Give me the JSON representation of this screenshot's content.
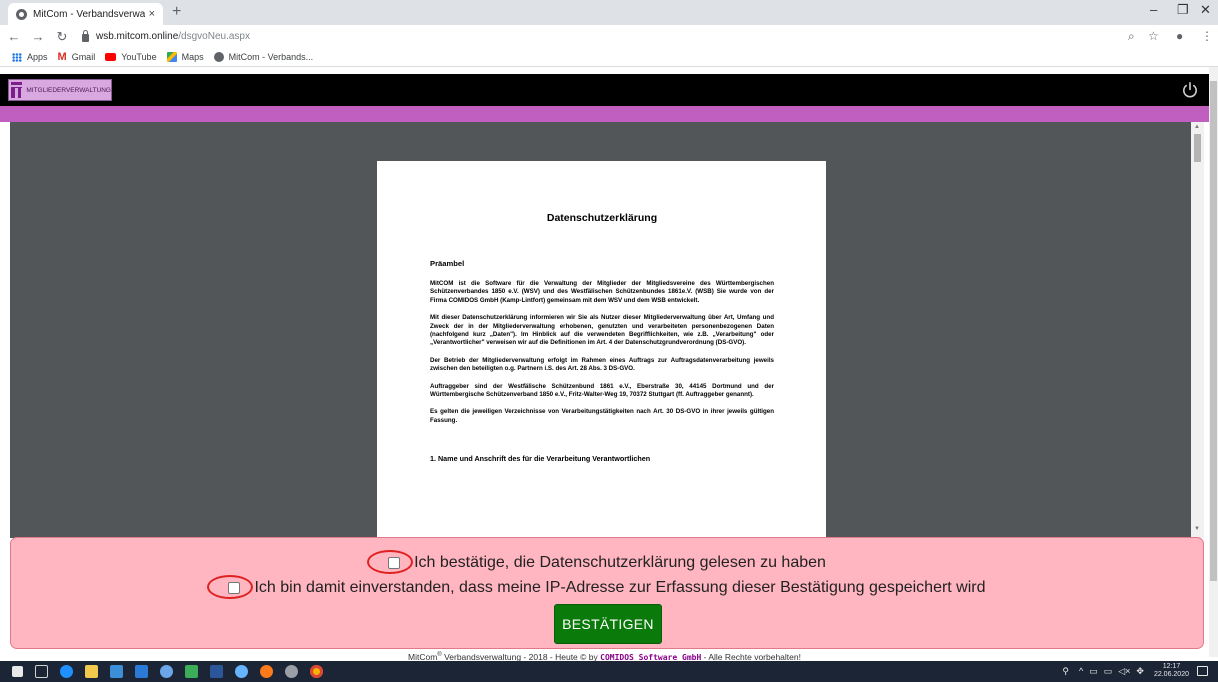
{
  "browser": {
    "tab_title": "MitCom - Verbandsverwaltung",
    "tab_close": "×",
    "new_tab": "+",
    "url_host": "wsb.mitcom.online",
    "url_path": "/dsgvoNeu.aspx",
    "bookmarks": [
      {
        "label": "Apps",
        "icon": "apps-icon"
      },
      {
        "label": "Gmail",
        "icon": "gmail-icon"
      },
      {
        "label": "YouTube",
        "icon": "youtube-icon"
      },
      {
        "label": "Maps",
        "icon": "maps-icon"
      },
      {
        "label": "MitCom - Verbands...",
        "icon": "mitcom-icon"
      }
    ]
  },
  "app": {
    "logo_text": "MITGLIEDERVERWALTUNG",
    "accent_color": "#c05fc0"
  },
  "document": {
    "title": "Datenschutzerklärung",
    "preamble_heading": "Präambel",
    "paragraphs": [
      "MitCOM ist die Software für die Verwaltung der Mitglieder der Mitgliedsvereine des Württembergischen Schützenverbandes 1850 e.V. (WSV) und des Westfälischen Schützenbundes 1861e.V. (WSB) Sie wurde von der Firma COMIDOS GmbH (Kamp-Lintfort) gemeinsam mit dem WSV und dem WSB entwickelt.",
      "Mit dieser Datenschutzerklärung informieren wir Sie als Nutzer dieser Mitgliederverwaltung über Art, Umfang und Zweck der in der Mitgliederverwaltung erhobenen, genutzten und verarbeiteten personenbezogenen Daten (nachfolgend kurz „Daten\"). Im Hinblick auf die verwendeten Begrifflichkeiten, wie z.B. „Verarbeitung\" oder „Verantwortlicher\" verweisen wir auf die Definitionen im Art. 4 der Datenschutzgrundverordnung (DS-GVO).",
      "Der Betrieb der Mitgliederverwaltung erfolgt im Rahmen eines Auftrags zur Auftragsdatenverarbeitung jeweils zwischen den beteiligten o.g. Partnern i.S. des Art. 28 Abs. 3 DS-GVO.",
      "Auftraggeber sind der Westfälische Schützenbund 1861 e.V., Eberstraße 30, 44145 Dortmund und der Württembergische Schützenverband 1850 e.V., Fritz-Walter-Weg 19, 70372 Stuttgart (ff. Auftraggeber genannt).",
      "Es gelten die jeweiligen Verzeichnisse von Verarbeitungstätigkeiten nach Art. 30 DS-GVO in ihrer jeweils gültigen Fassung."
    ],
    "section_1_heading": "1. Name und Anschrift des für die Verarbeitung Verantwortlichen"
  },
  "consent": {
    "checkbox_1_label": "Ich bestätige, die Datenschutzerklärung gelesen zu haben",
    "checkbox_1_checked": false,
    "checkbox_2_label": "Ich bin damit einverstanden, dass meine IP-Adresse zur Erfassung dieser Bestätigung gespeichert wird",
    "checkbox_2_checked": false,
    "confirm_button": "BESTÄTIGEN"
  },
  "footer": {
    "prefix": "MitCom",
    "reg": "®",
    "middle": " Verbandsverwaltung -  2018 - Heute © by ",
    "brand": "COMIDOS Software GmbH",
    "suffix": " - Alle Rechte vorbehalten!"
  },
  "taskbar": {
    "time": "12:17",
    "date": "22.06.2020"
  }
}
